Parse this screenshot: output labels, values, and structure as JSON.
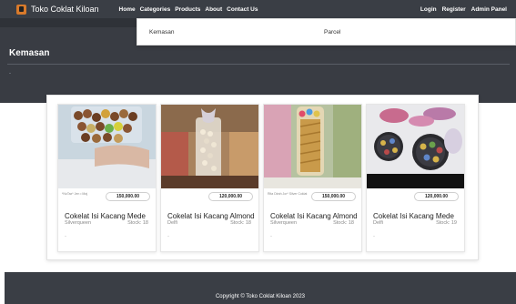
{
  "navbar": {
    "brand": "Toko Coklat Kiloan",
    "links": [
      "Home",
      "Categories",
      "Products",
      "About",
      "Contact Us"
    ],
    "right_links": [
      "Login",
      "Register",
      "Admin Panel"
    ]
  },
  "dropdown": {
    "items": [
      "Kemasan",
      "Parcel"
    ]
  },
  "header": {
    "title": "Kemasan",
    "subtitle": "-"
  },
  "products": [
    {
      "name": "Cokelat Isi Kacang Mede",
      "brand": "Silverqueen",
      "stock": "Stock: 18",
      "price": "150,000.00",
      "note": "*NoTax* Jen • Maj",
      "extra": "-"
    },
    {
      "name": "Cokelat Isi Kacang Almond",
      "brand": "Delfi",
      "stock": "Stock: 18",
      "price": "120,000.00",
      "note": "",
      "extra": "-"
    },
    {
      "name": "Cokelat Isi Kacang Almond",
      "brand": "Silverqueen",
      "stock": "Stock: 18",
      "price": "150,000.00",
      "note": "Rita Dirah Jor* Silver Coklat",
      "extra": "-"
    },
    {
      "name": "Cokelat Isi Kacang Mede",
      "brand": "Delfi",
      "stock": "Stock: 19",
      "price": "120,000.00",
      "note": "",
      "extra": "-"
    }
  ],
  "footer": {
    "text": "Copyright © Toko Coklat Kiloan 2023"
  }
}
